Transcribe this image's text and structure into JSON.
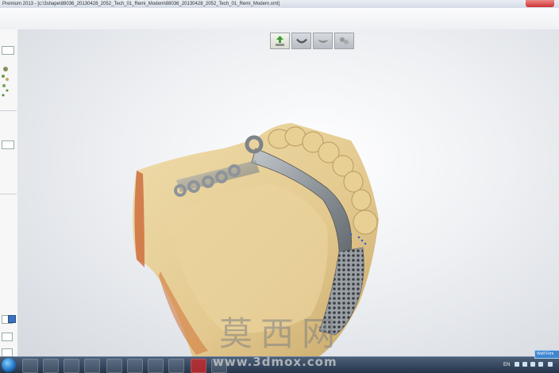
{
  "window": {
    "title": "Premium 2013 - [c:\\3shape\\88036_20130428_2052_Tech_01_Remi_Modern\\88036_20130428_2052_Tech_01_Remi_Modern.xml]"
  },
  "toolbar_3d": {
    "buttons": [
      {
        "name": "up-arrow-model-icon",
        "active": true
      },
      {
        "name": "lower-jaw-icon",
        "active": false
      },
      {
        "name": "upper-jaw-icon",
        "active": false
      },
      {
        "name": "teeth-icon",
        "active": false
      }
    ]
  },
  "sidebar": {
    "icon": "tooth-tree-icon",
    "blue_button_symbol": "?"
  },
  "taskbar": {
    "language": "EN",
    "apps": [
      "chrome-icon",
      "folder-icon",
      "media-icon",
      "app-icon",
      "explorer-icon",
      "window-icon",
      "monitor-icon",
      "app2-icon",
      "3shape-icon",
      "app3-icon"
    ],
    "notification": "Wolf Firm"
  },
  "watermark": {
    "chars": "莫西网",
    "url": "www.3dmox.com"
  },
  "colors": {
    "gypsum": "#e3c98f",
    "metal": "#8d9499",
    "viewport_bg": "#eef0f3",
    "taskbar": "#25354b"
  }
}
